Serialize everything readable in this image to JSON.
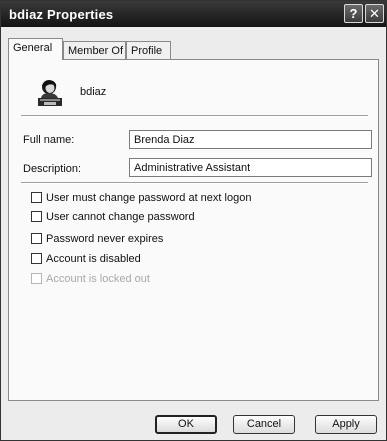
{
  "window": {
    "title": "bdiaz Properties",
    "help_glyph": "?",
    "close_glyph": "✕"
  },
  "tabs": [
    {
      "label": "General",
      "active": true
    },
    {
      "label": "Member Of",
      "active": false
    },
    {
      "label": "Profile",
      "active": false
    }
  ],
  "user": {
    "icon": "user-icon",
    "name": "bdiaz"
  },
  "fields": {
    "full_name": {
      "label": "Full name:",
      "value": "Brenda Diaz"
    },
    "description": {
      "label": "Description:",
      "value": "Administrative Assistant"
    }
  },
  "checkboxes": [
    {
      "label": "User must change password at next logon",
      "checked": false,
      "enabled": true
    },
    {
      "label": "User cannot change password",
      "checked": false,
      "enabled": true
    },
    {
      "label": "Password never expires",
      "checked": false,
      "enabled": true
    },
    {
      "label": "Account is disabled",
      "checked": false,
      "enabled": true
    },
    {
      "label": "Account is locked out",
      "checked": false,
      "enabled": false
    }
  ],
  "buttons": {
    "ok": "OK",
    "cancel": "Cancel",
    "apply": "Apply"
  }
}
